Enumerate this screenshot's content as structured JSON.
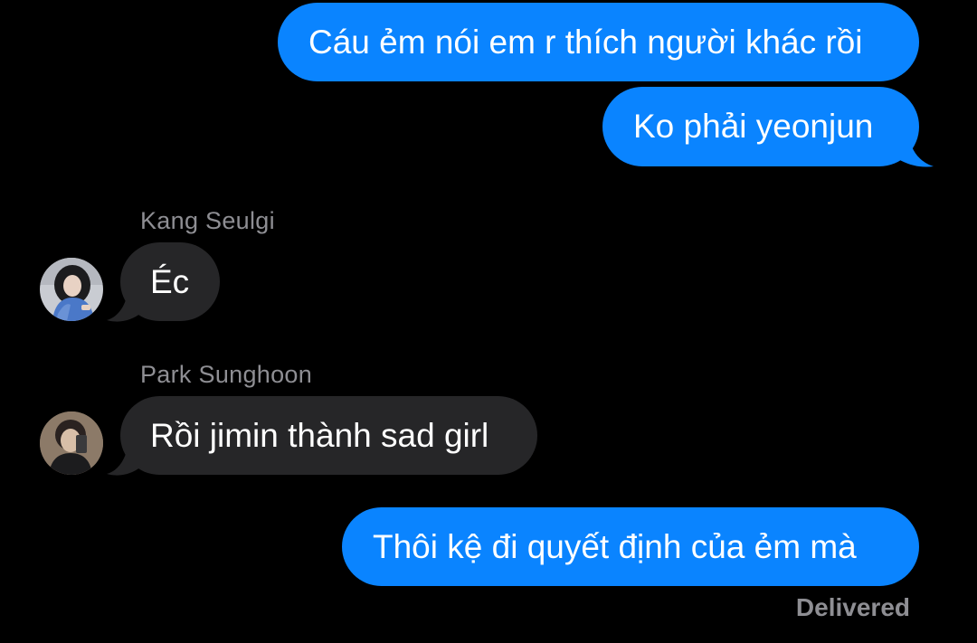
{
  "conversation": {
    "messages": [
      {
        "sender": "me",
        "text": "Cáu ẻm nói em r thích người khác rồi"
      },
      {
        "sender": "me",
        "text": "Ko phải yeonjun"
      },
      {
        "sender": "Kang Seulgi",
        "text": "Éc"
      },
      {
        "sender": "Park Sunghoon",
        "text": "Rồi jimin thành sad girl"
      },
      {
        "sender": "me",
        "text": "Thôi kệ đi quyết định của ẻm mà"
      }
    ],
    "status": "Delivered"
  },
  "colors": {
    "background": "#000000",
    "sent_bubble": "#0a84ff",
    "received_bubble": "#262628",
    "secondary_text": "#8e8e93"
  },
  "icons": {
    "avatar_1": "avatar-photo-woman",
    "avatar_2": "avatar-photo-man"
  }
}
